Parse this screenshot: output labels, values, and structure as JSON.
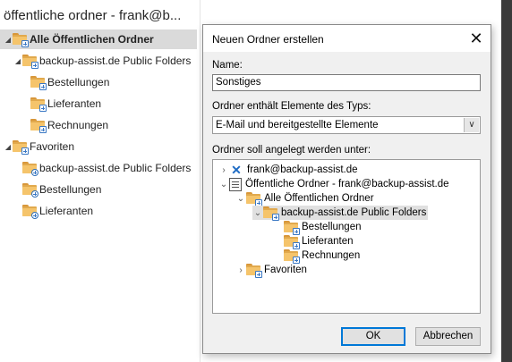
{
  "pane": {
    "title": "öffentliche ordner - frank@b...",
    "items": [
      {
        "label": "Alle Öffentlichen Ordner"
      },
      {
        "label": "backup-assist.de Public Folders"
      },
      {
        "label": "Bestellungen"
      },
      {
        "label": "Lieferanten"
      },
      {
        "label": "Rechnungen"
      },
      {
        "label": "Favoriten"
      },
      {
        "label": "backup-assist.de Public Folders"
      },
      {
        "label": "Bestellungen"
      },
      {
        "label": "Lieferanten"
      }
    ]
  },
  "dialog": {
    "title": "Neuen Ordner erstellen",
    "close_label": "✕",
    "name_label": "Name:",
    "name_value": "Sonstiges",
    "type_label": "Ordner enthält Elemente des Typs:",
    "type_value": "E-Mail und bereitgestellte Elemente",
    "location_label": "Ordner soll angelegt werden unter:",
    "tree": [
      {
        "label": "frank@backup-assist.de"
      },
      {
        "label": "Öffentliche Ordner - frank@backup-assist.de"
      },
      {
        "label": "Alle Öffentlichen Ordner"
      },
      {
        "label": "backup-assist.de Public Folders"
      },
      {
        "label": "Bestellungen"
      },
      {
        "label": "Lieferanten"
      },
      {
        "label": "Rechnungen"
      },
      {
        "label": "Favoriten"
      }
    ],
    "ok_label": "OK",
    "cancel_label": "Abbrechen"
  }
}
